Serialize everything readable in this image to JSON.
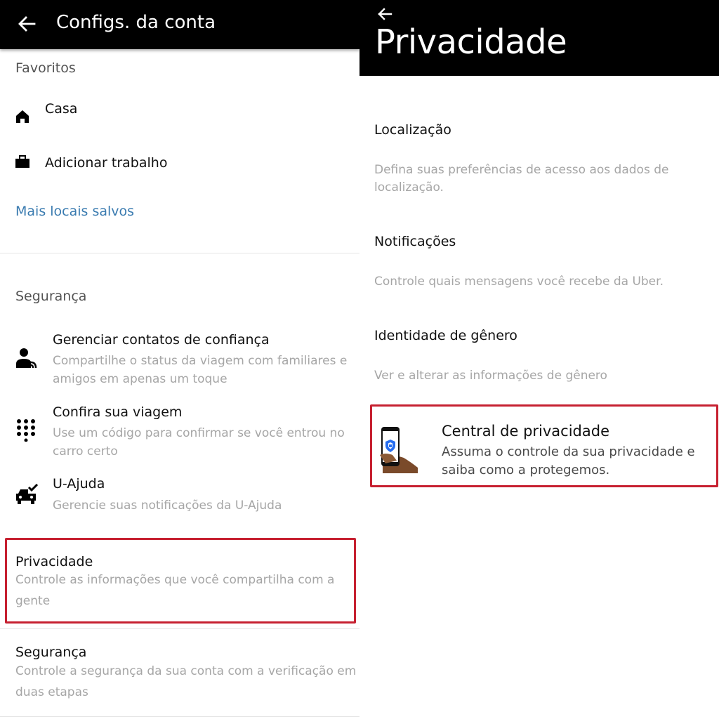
{
  "left": {
    "header": {
      "title": "Configs. da conta"
    },
    "favorites": {
      "label": "Favoritos",
      "home": "Casa",
      "work": "Adicionar trabalho",
      "more_link": "Mais locais salvos"
    },
    "security_section": {
      "label": "Segurança",
      "items": [
        {
          "title": "Gerenciar contatos de confiança",
          "sub1": "Compartilhe o status da viagem com familiares e",
          "sub2": "amigos em apenas um toque"
        },
        {
          "title": "Confira sua viagem",
          "sub1": "Use um código para confirmar se você entrou no",
          "sub2": "carro certo"
        },
        {
          "title": "U-Ajuda",
          "sub1": "Gerencie suas notificações da U-Ajuda"
        }
      ]
    },
    "privacy": {
      "title": "Privacidade",
      "sub1": "Controle as informações que você compartilha com a",
      "sub2": "gente"
    },
    "security": {
      "title": "Segurança",
      "sub1": "Controle a segurança da sua conta com a verificação em",
      "sub2": "duas etapas"
    }
  },
  "right": {
    "header": {
      "title": "Privacidade"
    },
    "items": [
      {
        "title": "Localização",
        "sub1": "Defina suas preferências de acesso aos dados de",
        "sub2": "localização."
      },
      {
        "title": "Notificações",
        "sub1": "Controle quais mensagens você recebe da Uber."
      },
      {
        "title": "Identidade de gênero",
        "sub1": "Ver e alterar as informações de gênero"
      }
    ],
    "center": {
      "title": "Central de privacidade",
      "sub1": "Assuma o controle da sua privacidade e",
      "sub2": "saiba como a protegemos."
    }
  },
  "colors": {
    "header_bg": "#000000",
    "highlight": "#c62030",
    "link": "#3a7bb0"
  },
  "icons": [
    "arrow-left-icon",
    "home-icon",
    "briefcase-icon",
    "contacts-icon",
    "keypad-icon",
    "car-check-icon",
    "phone-shield-icon"
  ]
}
